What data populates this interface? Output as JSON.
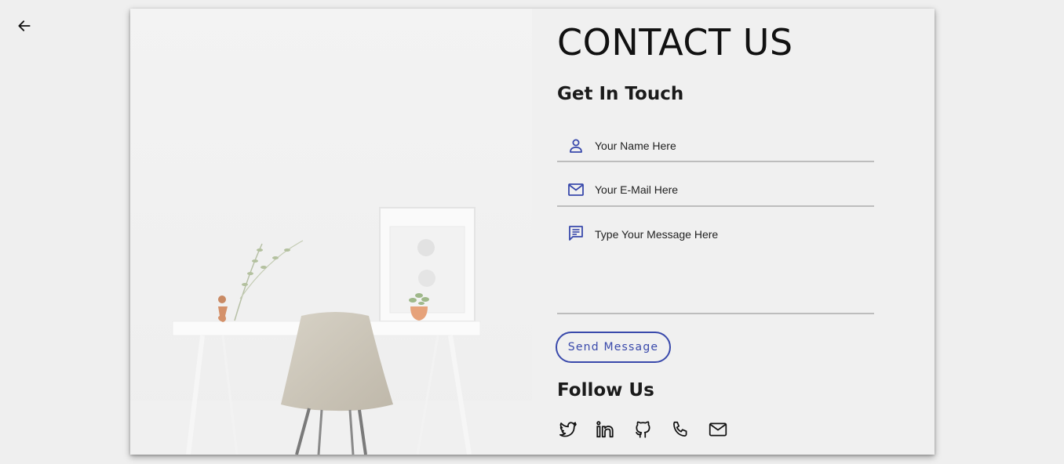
{
  "page": {
    "title": "CONTACT US",
    "back_icon": "arrow-left-icon"
  },
  "form": {
    "heading": "Get In Touch",
    "name": {
      "placeholder": "Your Name Here",
      "value": "",
      "icon": "person-icon"
    },
    "email": {
      "placeholder": "Your E-Mail Here",
      "value": "",
      "icon": "mail-icon"
    },
    "message": {
      "placeholder": "Type Your Message Here",
      "value": "",
      "icon": "message-icon"
    },
    "submit_label": "Send Message"
  },
  "follow": {
    "heading": "Follow Us",
    "links": [
      {
        "icon": "twitter-icon"
      },
      {
        "icon": "linkedin-icon"
      },
      {
        "icon": "github-icon"
      },
      {
        "icon": "phone-icon"
      },
      {
        "icon": "mail-icon"
      }
    ]
  },
  "colors": {
    "accent": "#3949ab",
    "page_background": "#efefef",
    "card_background": "#f0f0f0",
    "text": "#111111",
    "field_underline": "#bdbdbd"
  }
}
